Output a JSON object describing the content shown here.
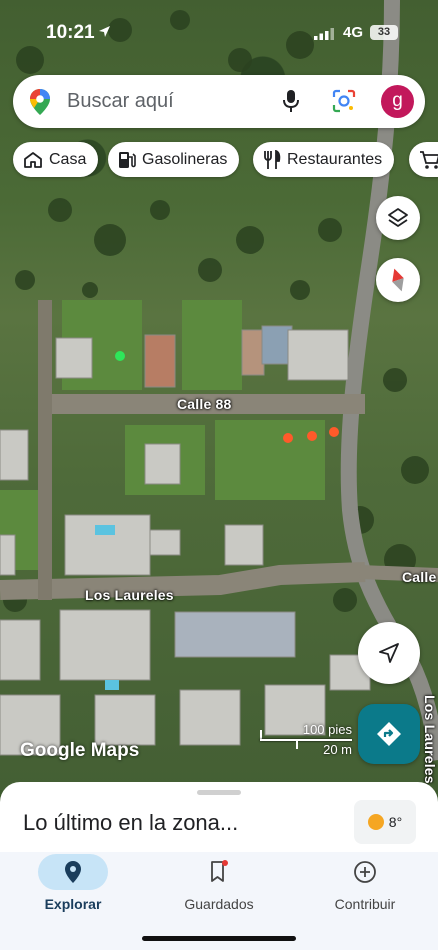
{
  "status_bar": {
    "time": "10:21",
    "network": "4G",
    "battery": "33"
  },
  "search": {
    "placeholder": "Buscar aquí",
    "avatar_initial": "g"
  },
  "chips": [
    {
      "label": "Casa",
      "icon": "home-icon"
    },
    {
      "label": "Gasolineras",
      "icon": "gas-station-icon"
    },
    {
      "label": "Restaurantes",
      "icon": "restaurant-icon"
    },
    {
      "label": "",
      "icon": "shopping-cart-icon"
    }
  ],
  "map": {
    "streets": [
      "Calle 88",
      "Los Laureles",
      "Calle",
      "Los Laureles"
    ],
    "attribution": "Google Maps",
    "scale": {
      "imperial": "100 pies",
      "metric": "20 m"
    },
    "marker_colors": {
      "green": "#2ee65a",
      "orange": "#ff5a2a"
    }
  },
  "buttons": {
    "layers": "layers-icon",
    "compass": "compass-icon",
    "my_location": "my-location-icon",
    "directions": "directions-icon"
  },
  "sheet": {
    "title": "Lo último en la zona...",
    "temperature": "8°"
  },
  "nav": {
    "items": [
      {
        "label": "Explorar",
        "icon": "explore-pin-icon",
        "active": true
      },
      {
        "label": "Guardados",
        "icon": "bookmark-icon",
        "active": false
      },
      {
        "label": "Contribuir",
        "icon": "add-circle-icon",
        "active": false
      }
    ]
  },
  "colors": {
    "accent": "#0b7a8a",
    "nav_active": "#c7e4f7",
    "avatar": "#c2185b"
  }
}
